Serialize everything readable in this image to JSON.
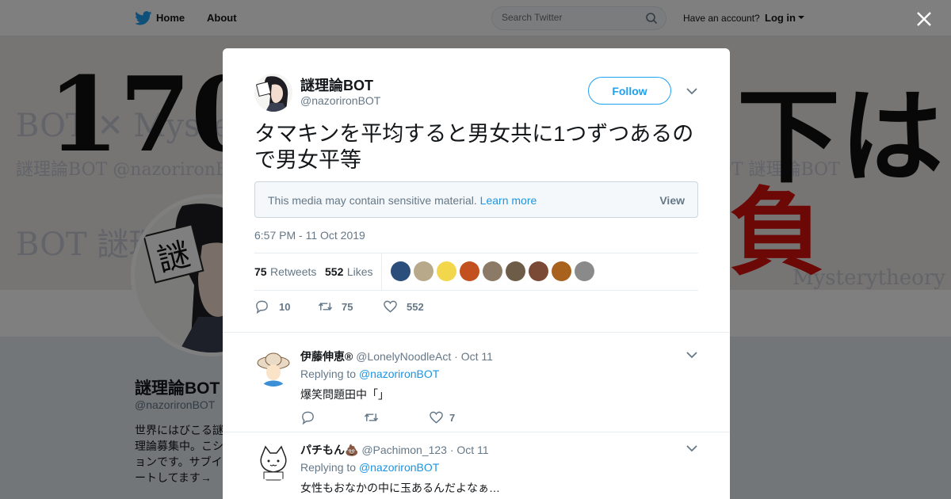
{
  "topbar": {
    "home_label": "Home",
    "about_label": "About",
    "search_placeholder": "Search Twitter",
    "have_account": "Have an account?",
    "login_label": "Log in"
  },
  "profile": {
    "name": "謎理論BOT",
    "handle": "@nazorironBOT",
    "bio": "世界にはびこる謎理論募集中。こションです。サブイートしてます→"
  },
  "tweet": {
    "name": "謎理論BOT",
    "handle": "@nazorironBOT",
    "follow_label": "Follow",
    "text": "タマキンを平均すると男女共に1つずつあるので男女平等",
    "sensitive_text": "This media may contain sensitive material.",
    "learn_more": "Learn more",
    "view_label": "View",
    "timestamp": "6:57 PM - 11 Oct 2019",
    "retweets_count": "75",
    "retweets_label": "Retweets",
    "likes_count": "552",
    "likes_label": "Likes",
    "reply_count": "10",
    "retweet_count": "75",
    "like_count": "552",
    "liker_colors": [
      "#2b4e7a",
      "#b7a98a",
      "#f2d64b",
      "#c3501f",
      "#8a7a66",
      "#6d5d48",
      "#7a4a36",
      "#a8621e",
      "#8a8a8a"
    ]
  },
  "replies": [
    {
      "name": "伊藤伸恵®",
      "handle": "@LonelyNoodleAct",
      "date": "Oct 11",
      "replying_prefix": "Replying to",
      "replying_to": "@nazorironBOT",
      "text": "爆笑問題田中「」",
      "reply_count": "",
      "retweet_count": "",
      "like_count": "7"
    },
    {
      "name": "パチもん💩",
      "handle": "@Pachimon_123",
      "date": "Oct 11",
      "replying_prefix": "Replying to",
      "replying_to": "@nazorironBOT",
      "text": "女性もおなかの中に玉あるんだよなぁ…"
    }
  ],
  "separator": "·",
  "banner": {
    "big_left": "170",
    "big_right": "下は",
    "red_char": "負"
  }
}
